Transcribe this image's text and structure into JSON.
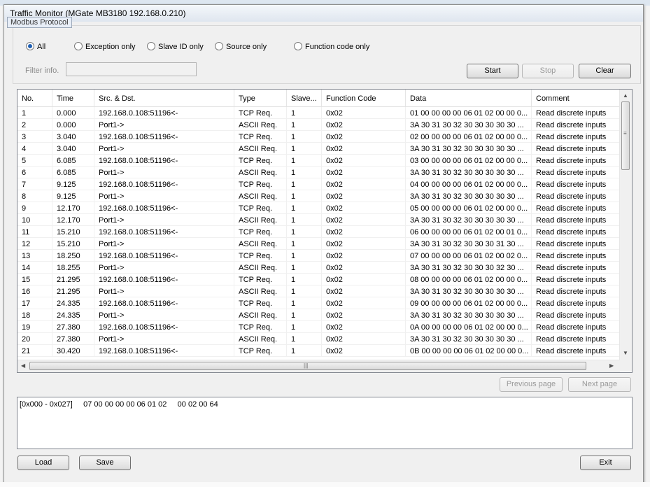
{
  "window": {
    "title": "Traffic Monitor (MGate MB3180 192.168.0.210)",
    "tooltip": "Modbus Protocol"
  },
  "filter": {
    "options": [
      {
        "label": "All",
        "selected": true
      },
      {
        "label": "Exception only",
        "selected": false
      },
      {
        "label": "Slave ID only",
        "selected": false
      },
      {
        "label": "Source only",
        "selected": false
      },
      {
        "label": "Function code only",
        "selected": false
      }
    ],
    "info_label": "Filter info.",
    "info_value": ""
  },
  "controls": {
    "start": "Start",
    "stop": "Stop",
    "clear": "Clear"
  },
  "table": {
    "columns": [
      "No.",
      "Time",
      "Src. & Dst.",
      "Type",
      "Slave...",
      "Function Code",
      "Data",
      "Comment"
    ],
    "rows": [
      [
        "1",
        "0.000",
        "192.168.0.108:51196<-",
        "TCP Req.",
        "1",
        "0x02",
        "01 00 00 00 00 06 01 02 00 00 0...",
        "Read discrete inputs"
      ],
      [
        "2",
        "0.000",
        "Port1->",
        "ASCII Req.",
        "1",
        "0x02",
        "3A 30 31 30 32 30 30 30 30 30 ...",
        "Read discrete inputs"
      ],
      [
        "3",
        "3.040",
        "192.168.0.108:51196<-",
        "TCP Req.",
        "1",
        "0x02",
        "02 00 00 00 00 06 01 02 00 00 0...",
        "Read discrete inputs"
      ],
      [
        "4",
        "3.040",
        "Port1->",
        "ASCII Req.",
        "1",
        "0x02",
        "3A 30 31 30 32 30 30 30 30 30 ...",
        "Read discrete inputs"
      ],
      [
        "5",
        "6.085",
        "192.168.0.108:51196<-",
        "TCP Req.",
        "1",
        "0x02",
        "03 00 00 00 00 06 01 02 00 00 0...",
        "Read discrete inputs"
      ],
      [
        "6",
        "6.085",
        "Port1->",
        "ASCII Req.",
        "1",
        "0x02",
        "3A 30 31 30 32 30 30 30 30 30 ...",
        "Read discrete inputs"
      ],
      [
        "7",
        "9.125",
        "192.168.0.108:51196<-",
        "TCP Req.",
        "1",
        "0x02",
        "04 00 00 00 00 06 01 02 00 00 0...",
        "Read discrete inputs"
      ],
      [
        "8",
        "9.125",
        "Port1->",
        "ASCII Req.",
        "1",
        "0x02",
        "3A 30 31 30 32 30 30 30 30 30 ...",
        "Read discrete inputs"
      ],
      [
        "9",
        "12.170",
        "192.168.0.108:51196<-",
        "TCP Req.",
        "1",
        "0x02",
        "05 00 00 00 00 06 01 02 00 00 0...",
        "Read discrete inputs"
      ],
      [
        "10",
        "12.170",
        "Port1->",
        "ASCII Req.",
        "1",
        "0x02",
        "3A 30 31 30 32 30 30 30 30 30 ...",
        "Read discrete inputs"
      ],
      [
        "11",
        "15.210",
        "192.168.0.108:51196<-",
        "TCP Req.",
        "1",
        "0x02",
        "06 00 00 00 00 06 01 02 00 01 0...",
        "Read discrete inputs"
      ],
      [
        "12",
        "15.210",
        "Port1->",
        "ASCII Req.",
        "1",
        "0x02",
        "3A 30 31 30 32 30 30 30 31 30 ...",
        "Read discrete inputs"
      ],
      [
        "13",
        "18.250",
        "192.168.0.108:51196<-",
        "TCP Req.",
        "1",
        "0x02",
        "07 00 00 00 00 06 01 02 00 02 0...",
        "Read discrete inputs"
      ],
      [
        "14",
        "18.255",
        "Port1->",
        "ASCII Req.",
        "1",
        "0x02",
        "3A 30 31 30 32 30 30 30 32 30 ...",
        "Read discrete inputs"
      ],
      [
        "15",
        "21.295",
        "192.168.0.108:51196<-",
        "TCP Req.",
        "1",
        "0x02",
        "08 00 00 00 00 06 01 02 00 00 0...",
        "Read discrete inputs"
      ],
      [
        "16",
        "21.295",
        "Port1->",
        "ASCII Req.",
        "1",
        "0x02",
        "3A 30 31 30 32 30 30 30 30 30 ...",
        "Read discrete inputs"
      ],
      [
        "17",
        "24.335",
        "192.168.0.108:51196<-",
        "TCP Req.",
        "1",
        "0x02",
        "09 00 00 00 00 06 01 02 00 00 0...",
        "Read discrete inputs"
      ],
      [
        "18",
        "24.335",
        "Port1->",
        "ASCII Req.",
        "1",
        "0x02",
        "3A 30 31 30 32 30 30 30 30 30 ...",
        "Read discrete inputs"
      ],
      [
        "19",
        "27.380",
        "192.168.0.108:51196<-",
        "TCP Req.",
        "1",
        "0x02",
        "0A 00 00 00 00 06 01 02 00 00 0...",
        "Read discrete inputs"
      ],
      [
        "20",
        "27.380",
        "Port1->",
        "ASCII Req.",
        "1",
        "0x02",
        "3A 30 31 30 32 30 30 30 30 30 ...",
        "Read discrete inputs"
      ],
      [
        "21",
        "30.420",
        "192.168.0.108:51196<-",
        "TCP Req.",
        "1",
        "0x02",
        "0B 00 00 00 00 06 01 02 00 00 0...",
        "Read discrete inputs"
      ]
    ]
  },
  "paging": {
    "previous": "Previous page",
    "next": "Next page"
  },
  "detail": {
    "text": "[0x000 - 0x027]     07 00 00 00 00 06 01 02     00 02 00 64"
  },
  "footer": {
    "load": "Load",
    "save": "Save",
    "exit": "Exit"
  },
  "icons": {
    "vscroll_up": "scroll-up-arrow",
    "vscroll_down": "scroll-down-arrow",
    "hscroll_left": "scroll-left-arrow",
    "hscroll_right": "scroll-right-arrow"
  },
  "colors": {
    "radio_selected": "#1f5fb3",
    "disabled_text": "#9a9a9a"
  }
}
